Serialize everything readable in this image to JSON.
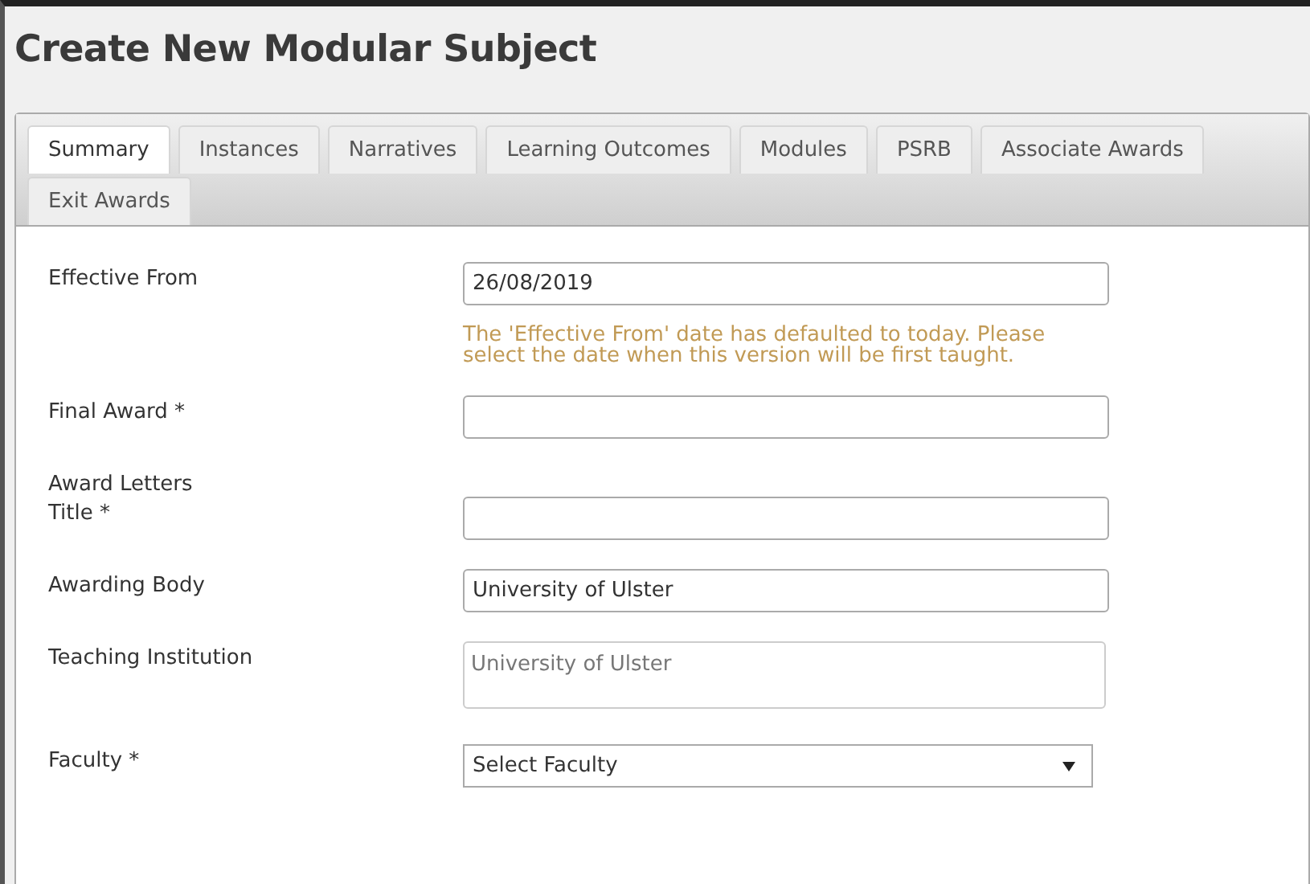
{
  "page": {
    "title": "Create New Modular Subject"
  },
  "tabs": [
    {
      "label": "Summary",
      "selected": true
    },
    {
      "label": "Instances",
      "selected": false
    },
    {
      "label": "Narratives",
      "selected": false
    },
    {
      "label": "Learning Outcomes",
      "selected": false
    },
    {
      "label": "Modules",
      "selected": false
    },
    {
      "label": "PSRB",
      "selected": false
    },
    {
      "label": "Associate Awards",
      "selected": false
    },
    {
      "label": "Exit Awards",
      "selected": false
    }
  ],
  "fields": [
    {
      "label": "Effective From",
      "kind": "input",
      "value": "26/08/2019",
      "hint": "The 'Effective From' date has defaulted to today. Please select the date when this version will be first taught."
    },
    {
      "label": "Final Award *",
      "kind": "input"
    },
    {
      "label": "Award Letters",
      "kind": "none"
    },
    {
      "label": "Title *",
      "kind": "input"
    },
    {
      "label": "Awarding Body",
      "kind": "input",
      "value": "University of Ulster"
    },
    {
      "label": "Teaching Institution",
      "kind": "textarea",
      "value": "University of Ulster",
      "disabled": true
    },
    {
      "label": "Faculty *",
      "kind": "select",
      "value": "Select Faculty"
    }
  ]
}
